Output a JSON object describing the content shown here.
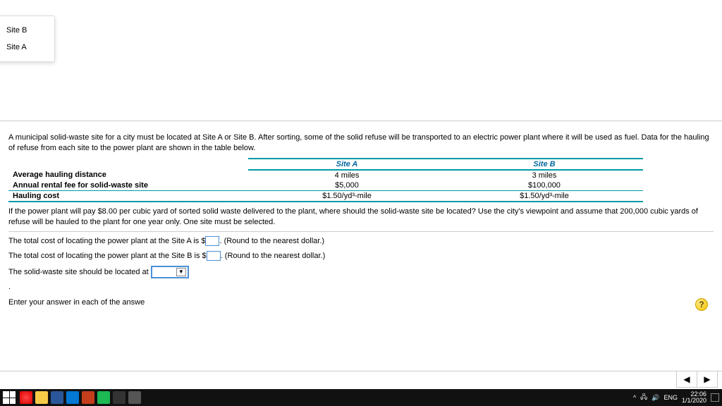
{
  "problem": {
    "intro": "A municipal solid-waste site for a city must be located at Site A or Site B. After sorting, some of the solid refuse will be transported to an electric power plant where it will be used as fuel. Data for the hauling of refuse from each site to the power plant are shown in the table below.",
    "followup": "If the power plant will pay $8.00 per cubic yard of sorted solid waste delivered to the plant, where should the solid-waste site be located? Use the city's viewpoint and assume that 200,000 cubic yards of refuse will be hauled to the plant for one year only. One site must be selected."
  },
  "table": {
    "colA": "Site A",
    "colB": "Site B",
    "rows": [
      {
        "label": "Average hauling distance",
        "a": "4 miles",
        "b": "3 miles"
      },
      {
        "label": "Annual rental fee for solid-waste site",
        "a": "$5,000",
        "b": "$100,000"
      },
      {
        "label": "Hauling cost",
        "a": "$1.50/yd³-mile",
        "b": "$1.50/yd³-mile"
      }
    ]
  },
  "questions": {
    "qA_pre": "The total cost of locating the power plant at the Site A is $",
    "qA_post": ". (Round to the nearest dollar.)",
    "qB_pre": "The total cost of locating the power plant at the Site B is $",
    "qB_post": ". (Round to the nearest dollar.)",
    "qC_pre": "The solid-waste site should be located at ",
    "qC_post": ".",
    "footer": "Enter your answer in each of the answe"
  },
  "dropdown": {
    "options": [
      "Site B",
      "Site A"
    ]
  },
  "nav": {
    "prev": "◀",
    "next": "▶"
  },
  "help": "?",
  "taskbar": {
    "tray": {
      "up": "^",
      "net": "🖧",
      "sound": "🔊",
      "lang": "ENG"
    },
    "clock": {
      "time": "22:06",
      "date": "1/1/2020"
    }
  }
}
